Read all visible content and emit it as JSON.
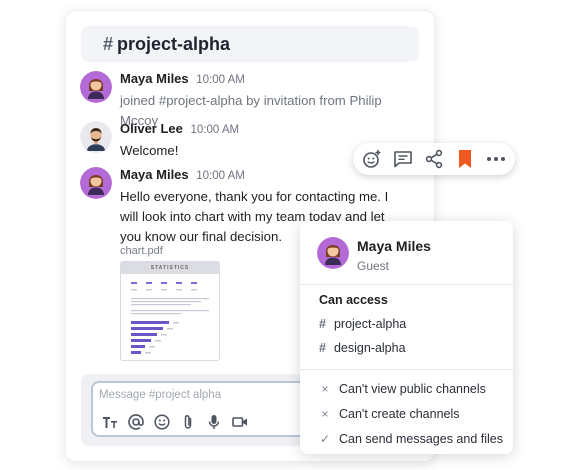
{
  "channel": {
    "hash": "#",
    "name": "project-alpha"
  },
  "messages": [
    {
      "author": "Maya Miles",
      "time": "10:00 AM",
      "text": "joined #project-alpha by invitation from Philip Mccoy"
    },
    {
      "author": "Oliver Lee",
      "time": "10:00 AM",
      "text": "Welcome!"
    },
    {
      "author": "Maya Miles",
      "time": "10:00 AM",
      "text": "Hello everyone, thank you for contacting me. I will look into chart with my team today and let you know our final decision."
    }
  ],
  "attachment": {
    "filename": "chart.pdf",
    "thumb_title": "STATISTICS"
  },
  "composer": {
    "placeholder": "Message #project alpha"
  },
  "composer_tools": [
    "text-format-icon",
    "mention-icon",
    "emoji-icon",
    "attach-icon",
    "microphone-icon",
    "video-icon"
  ],
  "reaction_bar": [
    "add-reaction-icon",
    "reply-thread-icon",
    "share-icon",
    "bookmark-icon",
    "more-icon"
  ],
  "profile": {
    "name": "Maya Miles",
    "role": "Guest",
    "access_title": "Can access",
    "channels": [
      "project-alpha",
      "design-alpha"
    ],
    "permissions": [
      {
        "icon": "×",
        "text": "Can't view public channels"
      },
      {
        "icon": "×",
        "text": "Can't create channels"
      },
      {
        "icon": "✓",
        "text": "Can send messages and files"
      }
    ]
  },
  "colors": {
    "accent": "#7c4dcc",
    "bookmark": "#f05a22",
    "header_bg": "#f2f4f7"
  }
}
